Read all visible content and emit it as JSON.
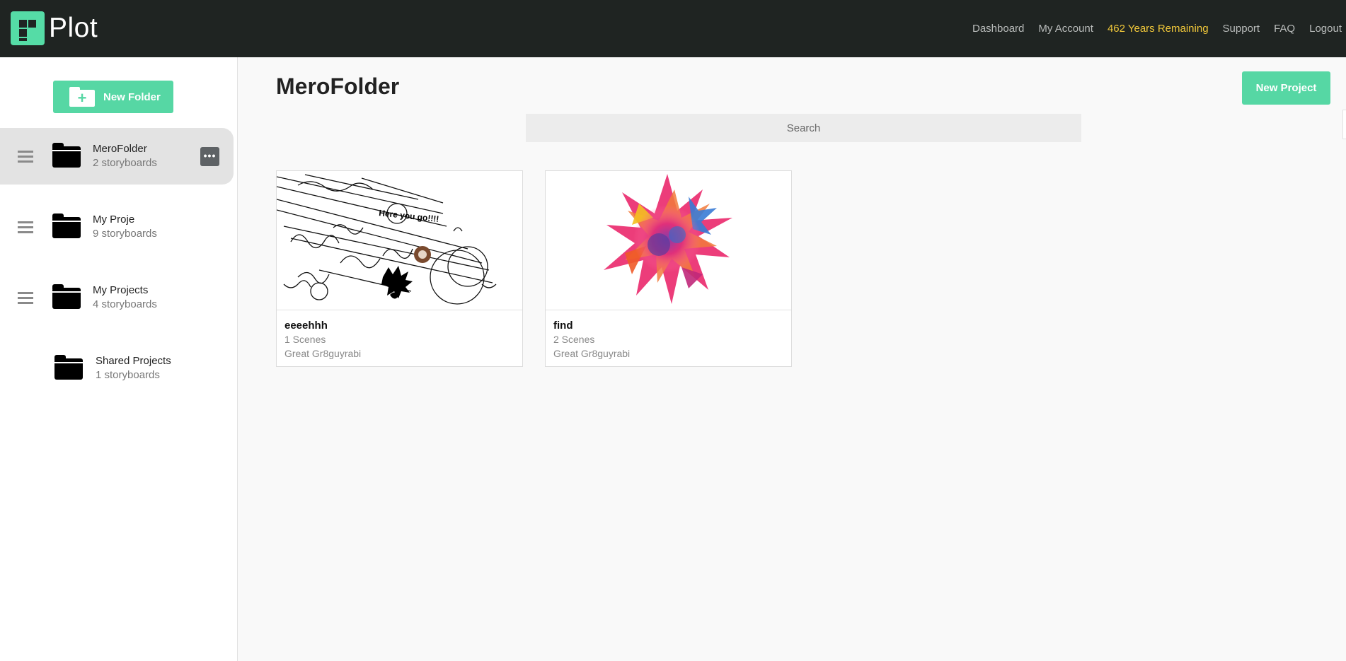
{
  "header": {
    "brand": "Plot",
    "nav": [
      {
        "label": "Dashboard"
      },
      {
        "label": "My Account"
      },
      {
        "label": "462 Years Remaining"
      },
      {
        "label": "Support"
      },
      {
        "label": "FAQ"
      },
      {
        "label": "Logout"
      }
    ],
    "highlight_color": "#f1c83a"
  },
  "sidebar": {
    "new_folder_label": "New Folder",
    "folders": [
      {
        "name": "MeroFolder",
        "count": "2 storyboards",
        "active": true
      },
      {
        "name": "My Proje",
        "count": "9 storyboards"
      },
      {
        "name": "My Projects",
        "count": "4 storyboards"
      },
      {
        "name": "Shared Projects",
        "count": "1 storyboards"
      }
    ],
    "more_label": "•••"
  },
  "main": {
    "title": "MeroFolder",
    "new_project_label": "New Project",
    "search_placeholder": "Search",
    "projects": [
      {
        "title": "eeeehhh",
        "scenes": "1 Scenes",
        "author": "Great Gr8guyrabi",
        "thumb_text": "Here you go!!!!"
      },
      {
        "title": "find",
        "scenes": "2 Scenes",
        "author": "Great Gr8guyrabi"
      }
    ]
  },
  "colors": {
    "accent": "#56d7a4",
    "topbar": "#1f2422"
  },
  "icons": [
    "logo-grid-icon",
    "folder-plus-icon",
    "drag-handle-icon",
    "folder-icon",
    "more-icon"
  ]
}
